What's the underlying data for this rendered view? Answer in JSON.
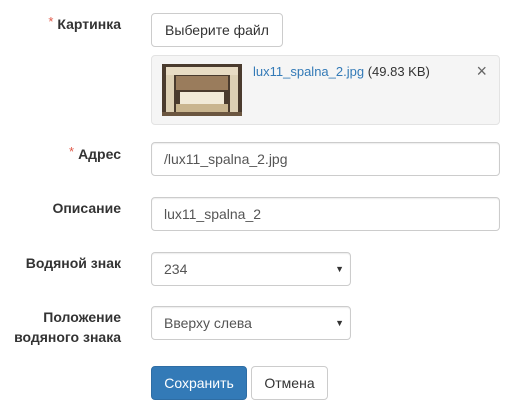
{
  "fields": {
    "picture": {
      "label": "Картинка",
      "required_mark": "*",
      "choose_button": "Выберите файл"
    },
    "uploaded_file": {
      "name": "lux11_spalna_2.jpg",
      "size": "(49.83 KB)",
      "remove_symbol": "×"
    },
    "address": {
      "label": "Адрес",
      "required_mark": "*",
      "value": "/lux11_spalna_2.jpg"
    },
    "description": {
      "label": "Описание",
      "value": "lux11_spalna_2"
    },
    "watermark": {
      "label": "Водяной знак",
      "selected": "234"
    },
    "watermark_position": {
      "label_line1": "Положение",
      "label_line2": "водяного знака",
      "selected": "Вверху слева"
    }
  },
  "actions": {
    "save": "Сохранить",
    "cancel": "Отмена"
  },
  "colors": {
    "primary": "#337ab7",
    "required": "#e05a4a",
    "link": "#337ab7"
  }
}
